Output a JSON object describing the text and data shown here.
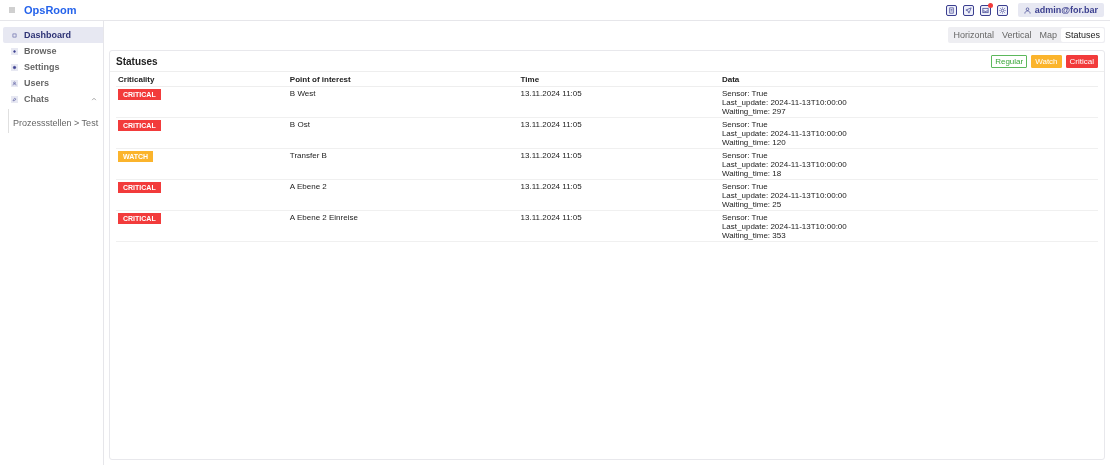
{
  "header": {
    "brand": "OpsRoom",
    "user": "admin@for.bar"
  },
  "sidebar": {
    "items": [
      {
        "label": "Dashboard",
        "selected": true
      },
      {
        "label": "Browse",
        "selected": false
      },
      {
        "label": "Settings",
        "selected": false
      },
      {
        "label": "Users",
        "selected": false
      },
      {
        "label": "Chats",
        "selected": false,
        "expanded": true,
        "children": [
          {
            "label": "Prozessstellen > Test",
            "selected": false
          }
        ]
      }
    ]
  },
  "view_tabs": [
    {
      "label": "Horizontal",
      "selected": false
    },
    {
      "label": "Vertical",
      "selected": false
    },
    {
      "label": "Map",
      "selected": false
    },
    {
      "label": "Statuses",
      "selected": true
    }
  ],
  "card": {
    "title": "Statuses",
    "legend": [
      {
        "label": "Regular",
        "kind": "regular"
      },
      {
        "label": "Watch",
        "kind": "watch"
      },
      {
        "label": "Critical",
        "kind": "critical"
      }
    ],
    "columns": [
      "Criticality",
      "Point of interest",
      "Time",
      "Data"
    ],
    "rows": [
      {
        "criticality": {
          "label": "CRITICAL",
          "kind": "critical"
        },
        "point_of_interest": "B West",
        "time": "13.11.2024 11:05",
        "data": [
          "Sensor: True",
          "Last_update: 2024-11-13T10:00:00",
          "Waiting_time: 297"
        ]
      },
      {
        "criticality": {
          "label": "CRITICAL",
          "kind": "critical"
        },
        "point_of_interest": "B Ost",
        "time": "13.11.2024 11:05",
        "data": [
          "Sensor: True",
          "Last_update: 2024-11-13T10:00:00",
          "Waiting_time: 120"
        ]
      },
      {
        "criticality": {
          "label": "WATCH",
          "kind": "watch"
        },
        "point_of_interest": "Transfer B",
        "time": "13.11.2024 11:05",
        "data": [
          "Sensor: True",
          "Last_update: 2024-11-13T10:00:00",
          "Waiting_time: 18"
        ]
      },
      {
        "criticality": {
          "label": "CRITICAL",
          "kind": "critical"
        },
        "point_of_interest": "A Ebene 2",
        "time": "13.11.2024 11:05",
        "data": [
          "Sensor: True",
          "Last_update: 2024-11-13T10:00:00",
          "Waiting_time: 25"
        ]
      },
      {
        "criticality": {
          "label": "CRITICAL",
          "kind": "critical"
        },
        "point_of_interest": "A Ebene 2 Einreise",
        "time": "13.11.2024 11:05",
        "data": [
          "Sensor: True",
          "Last_update: 2024-11-13T10:00:00",
          "Waiting_time: 353"
        ]
      }
    ]
  }
}
